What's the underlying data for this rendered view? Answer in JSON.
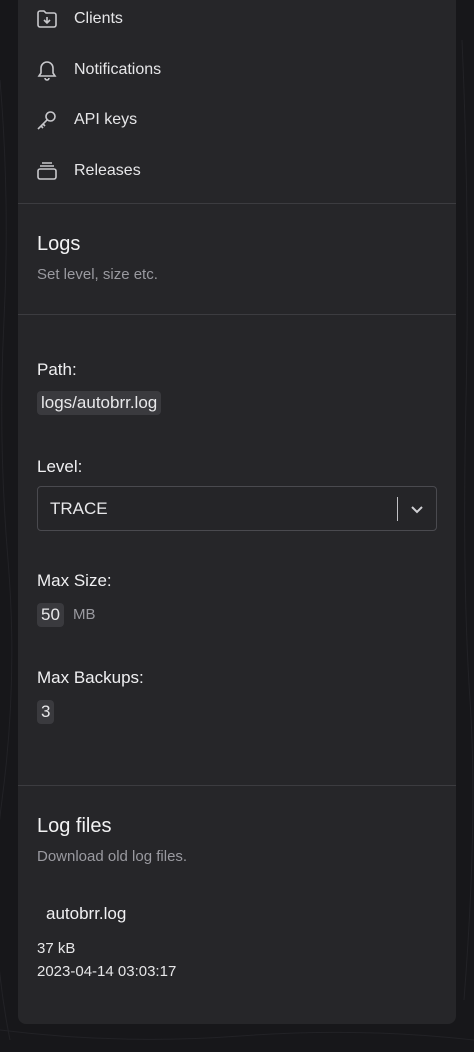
{
  "nav": {
    "items": [
      {
        "label": "Clients",
        "icon": "folder-download-icon"
      },
      {
        "label": "Notifications",
        "icon": "bell-icon"
      },
      {
        "label": "API keys",
        "icon": "key-icon"
      },
      {
        "label": "Releases",
        "icon": "archive-stack-icon"
      }
    ]
  },
  "logs": {
    "title": "Logs",
    "description": "Set level, size etc.",
    "path_label": "Path:",
    "path_value": "logs/autobrr.log",
    "level_label": "Level:",
    "level_value": "TRACE",
    "max_size_label": "Max Size:",
    "max_size_value": "50",
    "max_size_unit": "MB",
    "max_backups_label": "Max Backups:",
    "max_backups_value": "3"
  },
  "log_files": {
    "title": "Log files",
    "description": "Download old log files.",
    "files": [
      {
        "name": "autobrr.log",
        "size": "37 kB",
        "modified": "2023-04-14 03:03:17"
      }
    ]
  },
  "colors": {
    "background": "#17171a",
    "panel": "#262629",
    "chip": "#3a3a3e",
    "muted_text": "#9a9aa0"
  }
}
